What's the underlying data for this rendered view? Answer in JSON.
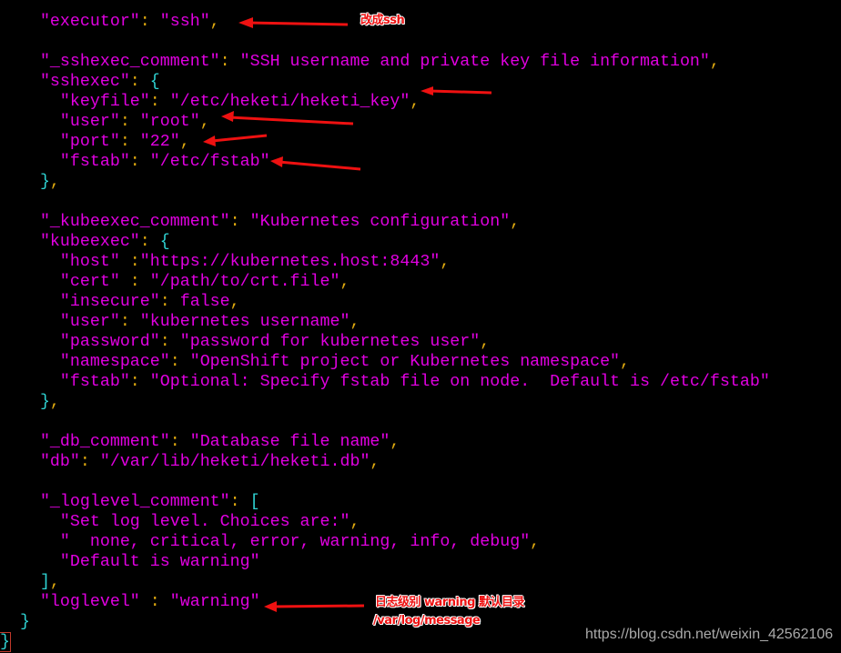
{
  "terminal": {
    "lines": [
      "    \"executor\": \"ssh\",",
      "",
      "    \"_sshexec_comment\": \"SSH username and private key file information\",",
      "    \"sshexec\": {",
      "      \"keyfile\": \"/etc/heketi/heketi_key\",",
      "      \"user\": \"root\",",
      "      \"port\": \"22\",",
      "      \"fstab\": \"/etc/fstab\"",
      "    },",
      "",
      "    \"_kubeexec_comment\": \"Kubernetes configuration\",",
      "    \"kubeexec\": {",
      "      \"host\" :\"https://kubernetes.host:8443\",",
      "      \"cert\" : \"/path/to/crt.file\",",
      "      \"insecure\": false,",
      "      \"user\": \"kubernetes username\",",
      "      \"password\": \"password for kubernetes user\",",
      "      \"namespace\": \"OpenShift project or Kubernetes namespace\",",
      "      \"fstab\": \"Optional: Specify fstab file on node.  Default is /etc/fstab\"",
      "    },",
      "",
      "    \"_db_comment\": \"Database file name\",",
      "    \"db\": \"/var/lib/heketi/heketi.db\",",
      "",
      "    \"_loglevel_comment\": [",
      "      \"Set log level. Choices are:\",",
      "      \"  none, critical, error, warning, info, debug\",",
      "      \"Default is warning\"",
      "    ],",
      "    \"loglevel\" : \"warning\"",
      "  }",
      "}"
    ],
    "colors": {
      "string": "#e100e1",
      "punctuation": "#e0aa10",
      "brace": "#2fd3d3"
    }
  },
  "annotations": {
    "executor_note": "改成ssh",
    "loglevel_note_line1": "日志级别 warning 默认目录",
    "loglevel_note_line2": "/var/log/message",
    "arrow_color": "#ee1111"
  },
  "watermark": "https://blog.csdn.net/weixin_42562106"
}
